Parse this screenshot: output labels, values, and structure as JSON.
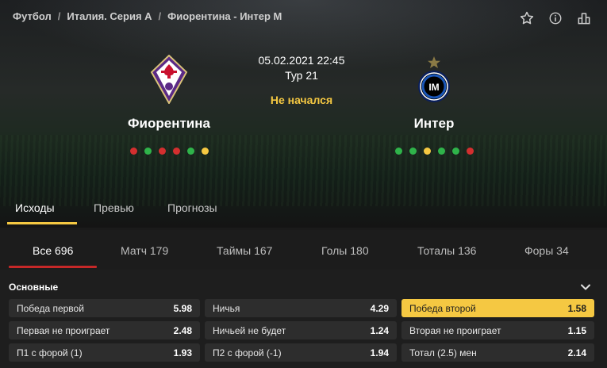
{
  "breadcrumb": [
    "Футбол",
    "Италия. Серия А",
    "Фиорентина - Интер М"
  ],
  "icons": {
    "favorite": "star-icon",
    "info": "info-icon",
    "stats": "stats-icon"
  },
  "match": {
    "datetime": "05.02.2021 22:45",
    "round": "Тур 21",
    "status": "Не начался"
  },
  "home": {
    "name": "Фиорентина",
    "form": [
      "loss",
      "win",
      "loss",
      "loss",
      "win",
      "draw"
    ]
  },
  "away": {
    "name": "Интер",
    "form": [
      "win",
      "win",
      "draw",
      "win",
      "win",
      "loss"
    ]
  },
  "form_colors": {
    "win": "#2fb34a",
    "loss": "#d32f2f",
    "draw": "#f5c842"
  },
  "main_tabs": [
    {
      "label": "Исходы",
      "active": true
    },
    {
      "label": "Превью",
      "active": false
    },
    {
      "label": "Прогнозы",
      "active": false
    }
  ],
  "market_tabs": [
    {
      "label": "Все 696",
      "active": true
    },
    {
      "label": "Матч 179",
      "active": false
    },
    {
      "label": "Таймы 167",
      "active": false
    },
    {
      "label": "Голы 180",
      "active": false
    },
    {
      "label": "Тоталы 136",
      "active": false
    },
    {
      "label": "Форы 34",
      "active": false
    }
  ],
  "section": {
    "title": "Основные",
    "rows": [
      [
        {
          "label": "Победа первой",
          "odd": "5.98"
        },
        {
          "label": "Ничья",
          "odd": "4.29"
        },
        {
          "label": "Победа второй",
          "odd": "1.58",
          "selected": true
        }
      ],
      [
        {
          "label": "Первая не проиграет",
          "odd": "2.48"
        },
        {
          "label": "Ничьей не будет",
          "odd": "1.24"
        },
        {
          "label": "Вторая не проиграет",
          "odd": "1.15"
        }
      ],
      [
        {
          "label": "П1 с форой (1)",
          "odd": "1.93"
        },
        {
          "label": "П2 с форой (-1)",
          "odd": "1.94"
        },
        {
          "label": "Тотал (2.5) мен",
          "odd": "2.14"
        }
      ]
    ]
  },
  "accent_color": "#f5c842",
  "market_underline_color": "#c62828"
}
